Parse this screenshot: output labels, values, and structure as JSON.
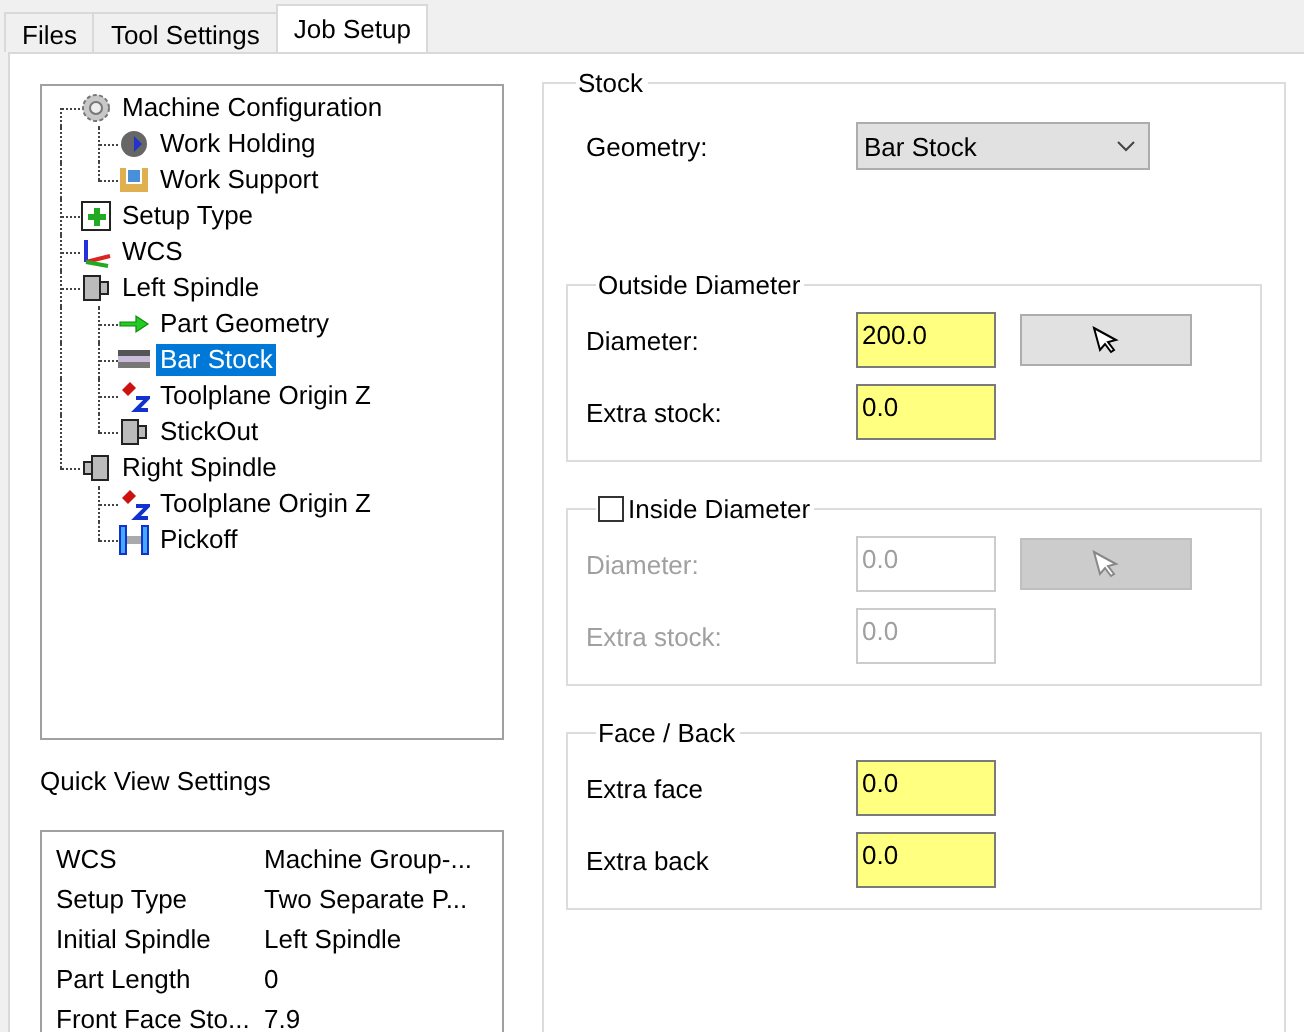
{
  "tabs": [
    {
      "label": "Files",
      "selected": false
    },
    {
      "label": "Tool Settings",
      "selected": false
    },
    {
      "label": "Job Setup",
      "selected": true
    }
  ],
  "tree": [
    {
      "label": "Machine Configuration",
      "kind": "gear",
      "selected": false,
      "children": [
        {
          "label": "Work Holding",
          "kind": "holding",
          "selected": false
        },
        {
          "label": "Work Support",
          "kind": "support",
          "selected": false
        }
      ]
    },
    {
      "label": "Setup Type",
      "kind": "setup",
      "selected": false
    },
    {
      "label": "WCS",
      "kind": "axes",
      "selected": false
    },
    {
      "label": "Left Spindle",
      "kind": "spindle",
      "selected": false,
      "children": [
        {
          "label": "Part Geometry",
          "kind": "part",
          "selected": false
        },
        {
          "label": "Bar Stock",
          "kind": "stock",
          "selected": true
        },
        {
          "label": "Toolplane Origin Z",
          "kind": "origin",
          "selected": false
        },
        {
          "label": "StickOut",
          "kind": "spindle",
          "selected": false
        }
      ]
    },
    {
      "label": "Right Spindle",
      "kind": "spindle_right",
      "selected": false,
      "children": [
        {
          "label": "Toolplane Origin Z",
          "kind": "origin",
          "selected": false
        },
        {
          "label": "Pickoff",
          "kind": "pickoff",
          "selected": false
        }
      ]
    }
  ],
  "quick_view": {
    "title": "Quick View Settings",
    "rows": [
      {
        "name": "WCS",
        "value": "Machine Group-..."
      },
      {
        "name": "Setup Type",
        "value": "Two Separate P..."
      },
      {
        "name": "Initial Spindle",
        "value": "Left Spindle"
      },
      {
        "name": "Part Length",
        "value": "0"
      },
      {
        "name": "Front Face Sto...",
        "value": "7.9"
      }
    ]
  },
  "stock": {
    "title": "Stock",
    "geometry": {
      "label": "Geometry:",
      "value": "Bar Stock"
    },
    "groups": [
      {
        "kind": "plain",
        "title": "Outside Diameter",
        "enabled": true,
        "fields": [
          {
            "label": "Diameter:",
            "value": "200.0",
            "pick_button": true
          },
          {
            "label": "Extra stock:",
            "value": "0.0"
          }
        ]
      },
      {
        "kind": "checkbox",
        "title": "Inside Diameter",
        "checked": false,
        "enabled": false,
        "fields": [
          {
            "label": "Diameter:",
            "value": "0.0",
            "pick_button": true
          },
          {
            "label": "Extra stock:",
            "value": "0.0"
          }
        ]
      },
      {
        "kind": "plain",
        "title": "Face / Back",
        "enabled": true,
        "fields": [
          {
            "label": "Extra face",
            "value": "0.0"
          },
          {
            "label": "Extra back",
            "value": "0.0"
          }
        ]
      }
    ]
  }
}
